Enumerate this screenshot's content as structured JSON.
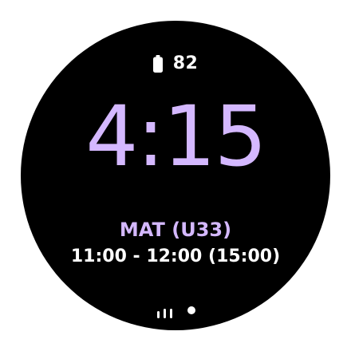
{
  "status": {
    "battery_icon": "battery-icon",
    "battery_level": "82"
  },
  "clock": {
    "time": "4:15"
  },
  "event": {
    "title": "MAT (U33)",
    "time_range": "11:00 - 12:00 (15:00)"
  },
  "pager": {
    "icons": [
      "tiles-bars-icon",
      "page-dot-icon"
    ]
  },
  "colors": {
    "accent": "#d4b8ff",
    "background": "#000000",
    "text": "#ffffff"
  }
}
